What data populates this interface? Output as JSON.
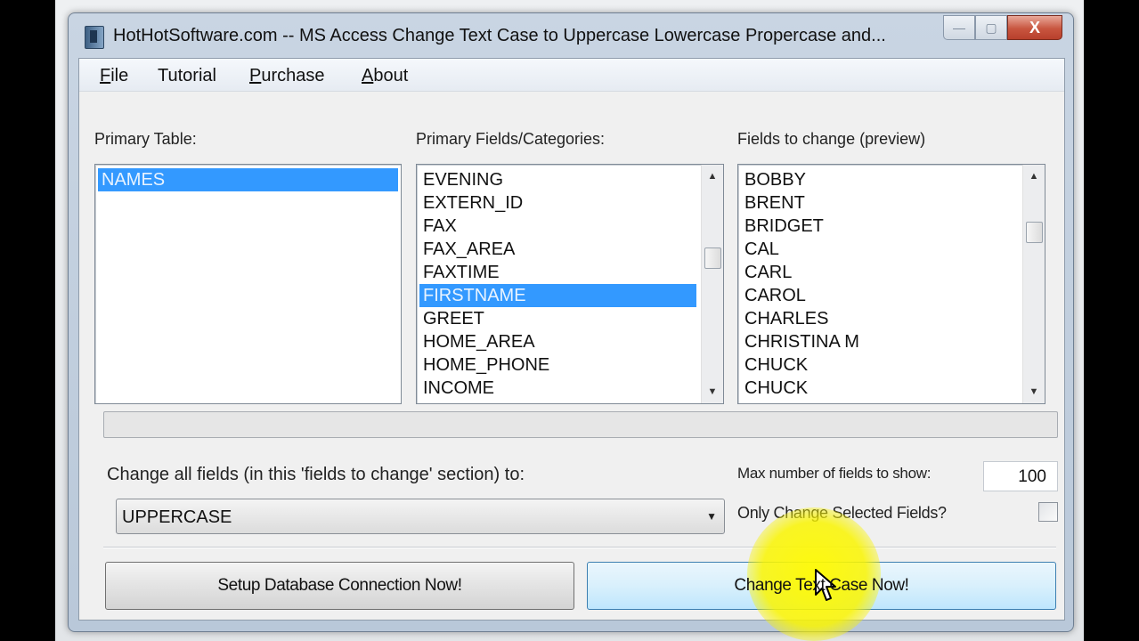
{
  "window": {
    "title": "HotHotSoftware.com -- MS Access Change Text Case to Uppercase Lowercase Propercase and...",
    "icon": "app-icon",
    "minimize_glyph": "—",
    "maximize_glyph": "▢",
    "close_glyph": "X"
  },
  "menu": {
    "file_acc": "F",
    "file_rest": "ile",
    "tutorial": "Tutorial",
    "purchase_acc": "P",
    "purchase_rest": "urchase",
    "about_acc": "A",
    "about_rest": "bout"
  },
  "primary_table": {
    "label": "Primary Table:",
    "items": [
      "NAMES"
    ],
    "selected_index": 0
  },
  "primary_fields": {
    "label": "Primary Fields/Categories:",
    "items": [
      "EVENING",
      "EXTERN_ID",
      "FAX",
      "FAX_AREA",
      "FAXTIME",
      "FIRSTNAME",
      "GREET",
      "HOME_AREA",
      "HOME_PHONE",
      "INCOME"
    ],
    "selected_index": 5,
    "scroll_position": 0.35
  },
  "fields_to_change": {
    "label": "Fields to change (preview)",
    "items": [
      "BOBBY",
      "BRENT",
      "BRIDGET",
      "CAL",
      "CARL",
      "CAROL",
      "CHARLES",
      "CHRISTINA M",
      "CHUCK",
      "CHUCK"
    ],
    "scroll_position": 0.2
  },
  "progress": {
    "value": 0
  },
  "change_all": {
    "label": "Change all fields (in this 'fields to change' section) to:",
    "selected": "UPPERCASE"
  },
  "max_fields": {
    "label": "Max number of fields to show:",
    "value": "100"
  },
  "only_selected": {
    "label": "Only Change Selected Fields?",
    "checked": false
  },
  "buttons": {
    "setup": "Setup Database Connection Now!",
    "change": "Change Text Case Now!"
  },
  "colors": {
    "selection": "#3399ff",
    "highlight": "#fff700"
  }
}
